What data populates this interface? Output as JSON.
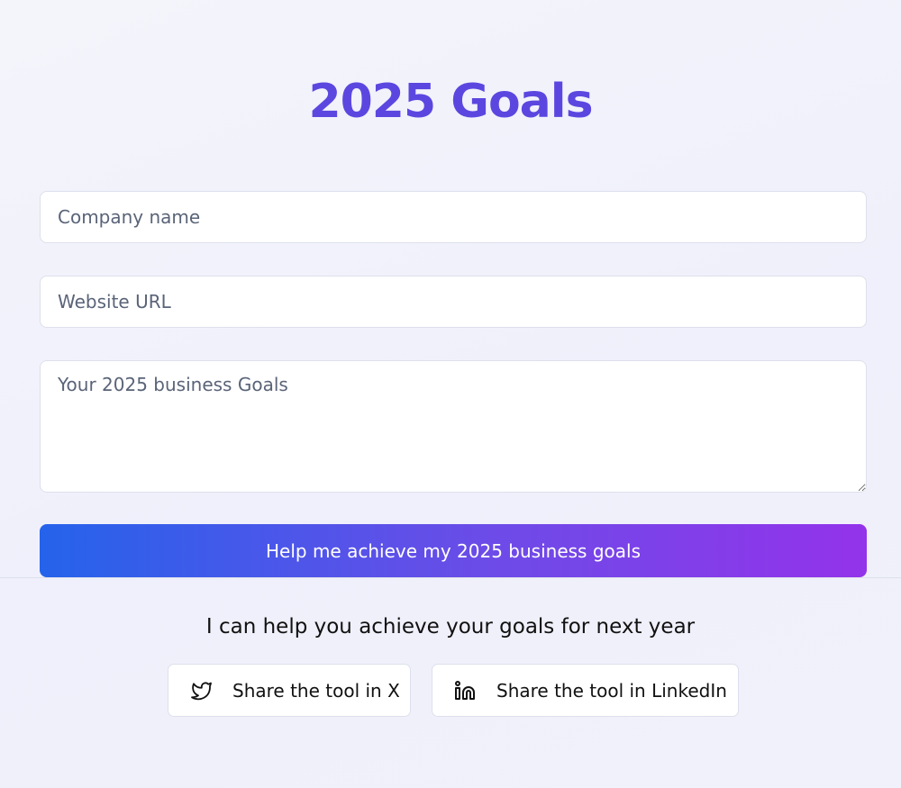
{
  "header": {
    "title": "2025 Goals"
  },
  "form": {
    "company_placeholder": "Company name",
    "company_value": "",
    "website_placeholder": "Website URL",
    "website_value": "",
    "goals_placeholder": "Your 2025 business Goals",
    "goals_value": "",
    "submit_label": "Help me achieve my 2025 business goals"
  },
  "footer": {
    "subtitle": "I can help you achieve your goals for next year",
    "share_x": {
      "label": "Share the tool in X",
      "icon": "twitter-bird-icon"
    },
    "share_linkedin": {
      "label": "Share the tool in LinkedIn",
      "icon": "linkedin-icon"
    }
  },
  "colors": {
    "title": "#5b47e0",
    "button_gradient_start": "#2563eb",
    "button_gradient_end": "#9333ea",
    "background": "#f2f2fb"
  }
}
